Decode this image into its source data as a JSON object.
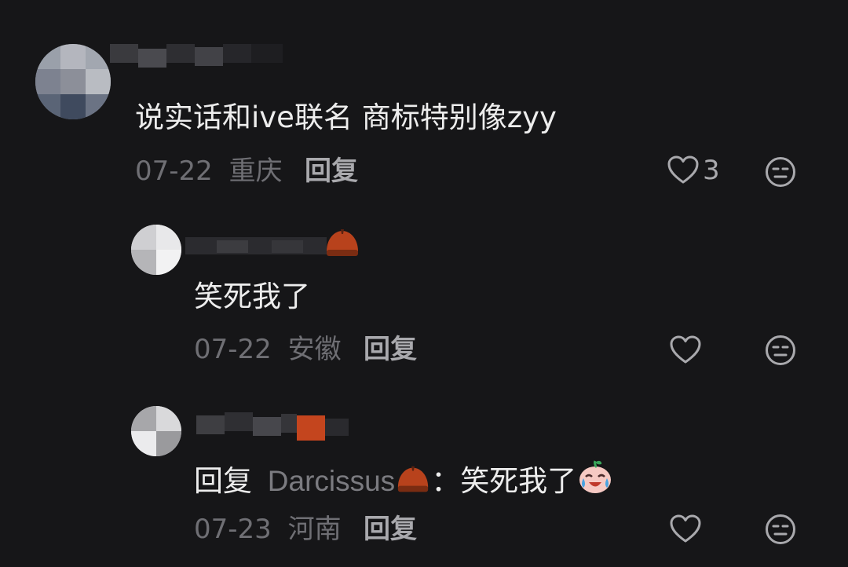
{
  "comments": [
    {
      "username": "",
      "text": "说实话和ive联名 商标特别像zyy",
      "date": "07-22",
      "location": "重庆",
      "reply_label": "回复",
      "like_count": "3",
      "icons": {
        "like": "heart-outline-icon",
        "dislike": "neutral-face-icon"
      }
    },
    {
      "username": "",
      "text": "笑死我了",
      "date": "07-22",
      "location": "安徽",
      "reply_label": "回复",
      "like_count": "",
      "icons": {
        "like": "heart-outline-icon",
        "dislike": "neutral-face-icon"
      }
    },
    {
      "username": "",
      "reply_prefix": "回复",
      "reply_target": "Darcissus",
      "reply_target_emoji": "chestnut-emoji",
      "reply_separator": "：",
      "text": "笑死我了",
      "trailing_emoji": "laughing-crying-emoji",
      "date": "07-23",
      "location": "河南",
      "reply_label": "回复",
      "like_count": "",
      "icons": {
        "like": "heart-outline-icon",
        "dislike": "neutral-face-icon"
      }
    }
  ],
  "colors": {
    "background": "#161618",
    "primary_text": "#ededed",
    "meta_text": "#6f6f74",
    "action_text": "#a9a9ad",
    "chestnut": "#b8421c"
  }
}
